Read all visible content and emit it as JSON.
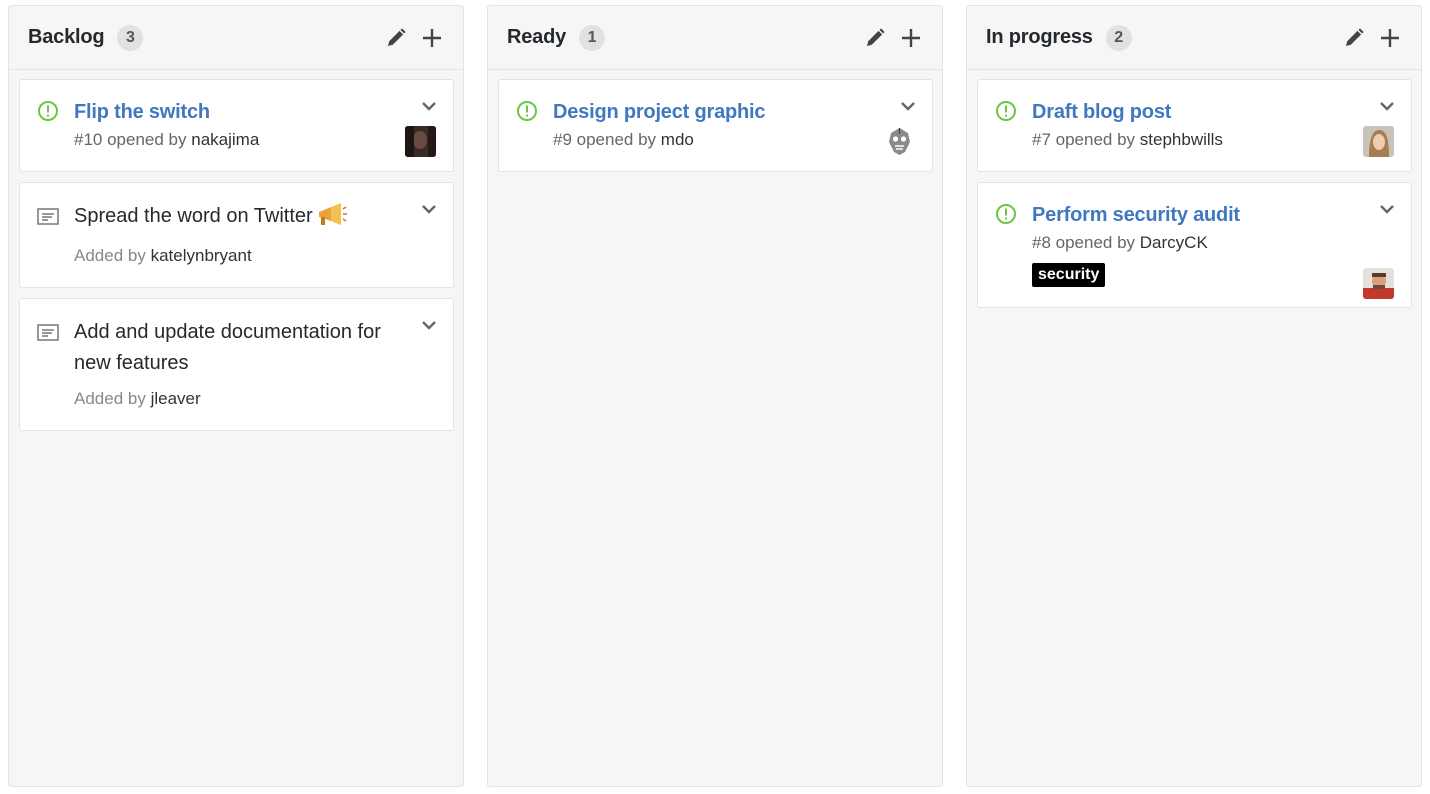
{
  "columns": [
    {
      "title": "Backlog",
      "count": "3",
      "cards": [
        {
          "type": "issue",
          "title": "Flip the switch",
          "meta_prefix": "#10 opened by",
          "user": "nakajima",
          "avatar": "avatar-nakajima"
        },
        {
          "type": "note",
          "text": "Spread the word on Twitter",
          "emoji": "megaphone",
          "meta_prefix": "Added by",
          "user": "katelynbryant"
        },
        {
          "type": "note",
          "text": "Add and update documentation for new features",
          "meta_prefix": "Added by",
          "user": "jleaver"
        }
      ]
    },
    {
      "title": "Ready",
      "count": "1",
      "cards": [
        {
          "type": "issue",
          "title": "Design project graphic",
          "meta_prefix": "#9 opened by",
          "user": "mdo",
          "avatar": "avatar-mdo"
        }
      ]
    },
    {
      "title": "In progress",
      "count": "2",
      "cards": [
        {
          "type": "issue",
          "title": "Draft blog post",
          "meta_prefix": "#7 opened by",
          "user": "stephbwills",
          "avatar": "avatar-stephbwills"
        },
        {
          "type": "issue",
          "title": "Perform security audit",
          "meta_prefix": "#8 opened by",
          "user": "DarcyCK",
          "label": "security",
          "avatar": "avatar-darcyck"
        }
      ]
    }
  ],
  "icons": {
    "edit": "pencil-icon",
    "add": "plus-icon",
    "issue": "issue-opened-icon",
    "note": "note-icon",
    "menu": "chevron-down-icon"
  },
  "colors": {
    "issue_open": "#6cc644",
    "link": "#4078c0",
    "label_security": "#000000"
  }
}
